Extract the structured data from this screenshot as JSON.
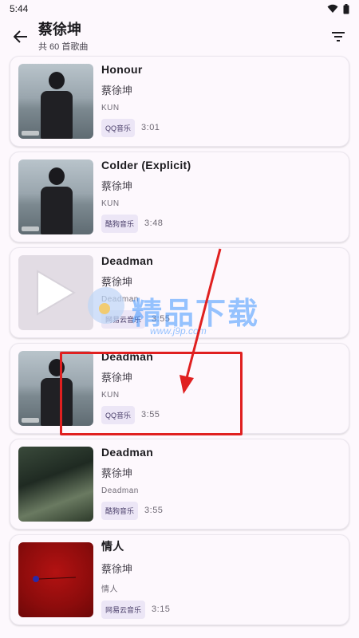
{
  "status": {
    "time": "5:44"
  },
  "header": {
    "title": "蔡徐坤",
    "subtitle": "共 60 首歌曲"
  },
  "songs": [
    {
      "title": "Honour",
      "artist": "蔡徐坤",
      "album": "KUN",
      "source": "QQ音乐",
      "duration": "3:01",
      "cover": "winter"
    },
    {
      "title": "Colder (Explicit)",
      "artist": "蔡徐坤",
      "album": "KUN",
      "source": "酷狗音乐",
      "duration": "3:48",
      "cover": "winter"
    },
    {
      "title": "Deadman",
      "artist": "蔡徐坤",
      "album": "Deadman",
      "source": "网易云音乐",
      "duration": "3:55",
      "cover": "play"
    },
    {
      "title": "Deadman",
      "artist": "蔡徐坤",
      "album": "KUN",
      "source": "QQ音乐",
      "duration": "3:55",
      "cover": "winter"
    },
    {
      "title": "Deadman",
      "artist": "蔡徐坤",
      "album": "Deadman",
      "source": "酷狗音乐",
      "duration": "3:55",
      "cover": "forest"
    },
    {
      "title": "情人",
      "artist": "蔡徐坤",
      "album": "情人",
      "source": "网易云音乐",
      "duration": "3:15",
      "cover": "red"
    }
  ],
  "watermark": {
    "text": "精品下载",
    "url": "www.j9p.com"
  },
  "colors": {
    "accent": "#ece6f6",
    "annotation": "#e02020"
  },
  "icons": {
    "back": "arrow-left",
    "filter": "filter-list",
    "wifi": "wifi",
    "battery": "battery"
  }
}
